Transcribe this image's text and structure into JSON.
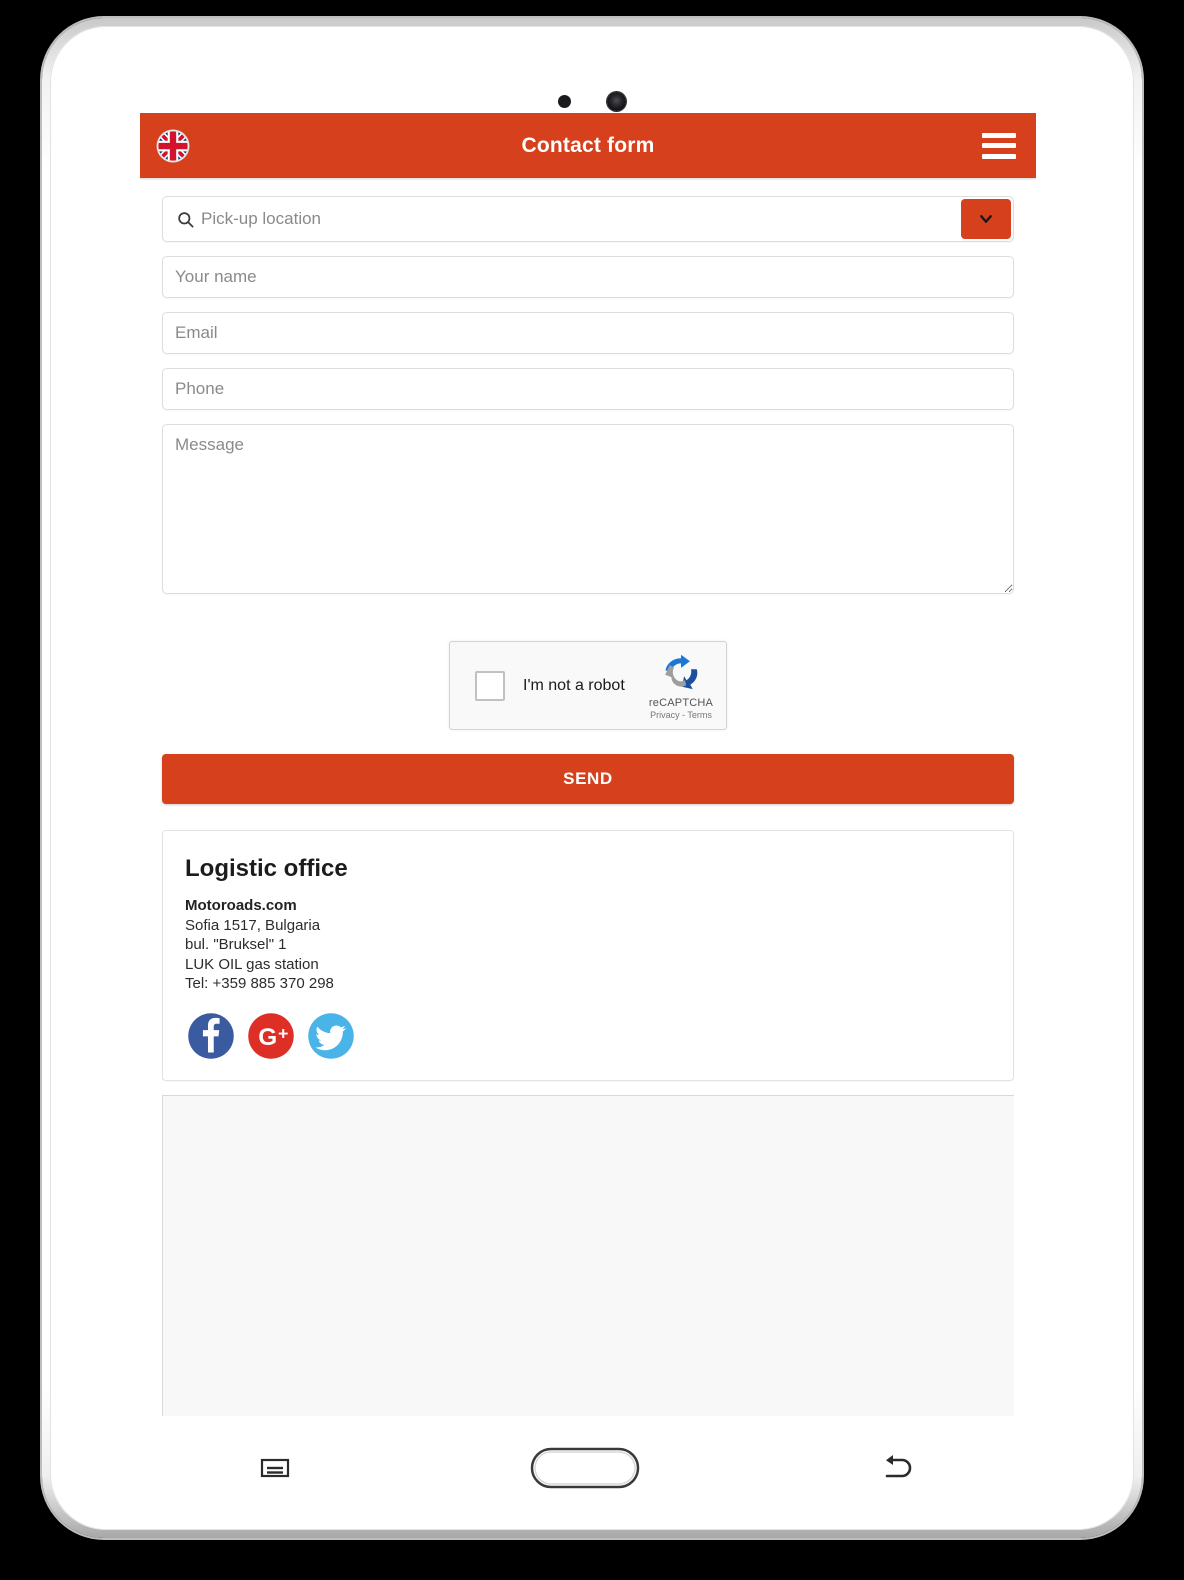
{
  "device": {
    "type": "white-android-tablet",
    "sensors": [
      "proximity-sensor",
      "front-camera"
    ]
  },
  "header": {
    "title": "Contact form",
    "accent_color": "#d6401d",
    "flag_icon": "uk-flag-icon",
    "menu_icon": "hamburger-menu-icon"
  },
  "form": {
    "pickup": {
      "placeholder": "Pick-up location",
      "value": "",
      "search_icon": "search-icon",
      "dropdown_icon": "chevron-down-icon"
    },
    "fields": [
      {
        "name": "your-name",
        "placeholder": "Your name",
        "value": ""
      },
      {
        "name": "email",
        "placeholder": "Email",
        "value": ""
      },
      {
        "name": "phone",
        "placeholder": "Phone",
        "value": ""
      }
    ],
    "message": {
      "placeholder": "Message",
      "value": ""
    },
    "submit_label": "SEND"
  },
  "recaptcha": {
    "label": "I'm not a robot",
    "brand": "reCAPTCHA",
    "legal": "Privacy - Terms",
    "logo_icon": "recaptcha-logo-icon",
    "checked": false
  },
  "office": {
    "title": "Logistic office",
    "company": "Motoroads.com",
    "lines": [
      "Sofia 1517, Bulgaria",
      "bul. \"Bruksel\" 1",
      "LUK OIL gas station",
      "Tel: +359 885 370 298"
    ],
    "social": [
      {
        "name": "facebook",
        "label": "f",
        "color": "#3b5ba1"
      },
      {
        "name": "google-plus",
        "label": "g+",
        "color": "#dd2f26"
      },
      {
        "name": "twitter",
        "label": "twitter-bird",
        "color": "#4ab3e8"
      }
    ]
  },
  "nav_bar": {
    "buttons": [
      {
        "name": "recents-button",
        "icon": "recents-icon"
      },
      {
        "name": "home-button",
        "icon": "home-icon"
      },
      {
        "name": "back-button",
        "icon": "back-arrow-icon"
      }
    ]
  }
}
